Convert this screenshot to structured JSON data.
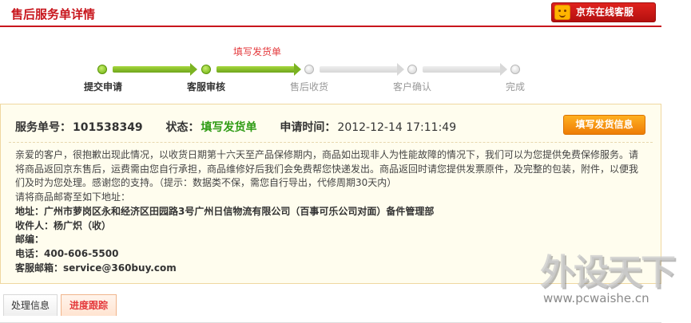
{
  "header": {
    "title": "售后服务单详情",
    "cs_button_label": "京东在线客服"
  },
  "progress": {
    "current_hint": "填写发货单",
    "steps": [
      {
        "label": "提交申请",
        "done": true
      },
      {
        "label": "客服审核",
        "done": true
      },
      {
        "label": "售后收货",
        "done": false
      },
      {
        "label": "客户确认",
        "done": false
      },
      {
        "label": "完成",
        "done": false
      }
    ]
  },
  "info": {
    "service_no_label": "服务单号：",
    "service_no": "101538349",
    "status_label": "状态：",
    "status": "填写发货单",
    "time_label": "申请时间：",
    "time": "2012-12-14 17:11:49",
    "fill_button_label": "填写发货信息",
    "notice_lines": [
      "亲爱的客户，很抱歉出现此情况，以收货日期第十六天至产品保修期内，商品如出现非人为性能故障的情况下，我们可以为您提供免费保修服务。请",
      "将商品返回京东售后，运费需由您自行承担，商品维修好后我们会免费帮您快递发出。商品返回时请您提供发票原件，及完整的包装，附件，以便我",
      "们及时为您处理。感谢您的支持。（提示：数据类不保，需您自行导出，代修周期30天内）",
      "请将商品邮寄至如下地址："
    ],
    "address": "地址：广州市萝岗区永和经济区田园路3号广州日信物流有限公司（百事可乐公司对面）备件管理部",
    "recipient": "收件人：杨广炽（收）",
    "postcode": "邮编：",
    "phone": "电话：400-606-5500",
    "email": "客服邮箱：service@360buy.com"
  },
  "tabs": [
    {
      "label": "处理信息",
      "active": false
    },
    {
      "label": "进度跟踪",
      "active": true
    }
  ],
  "watermark": {
    "main": "外设天下",
    "url": "www.pcwaishe.cn"
  }
}
